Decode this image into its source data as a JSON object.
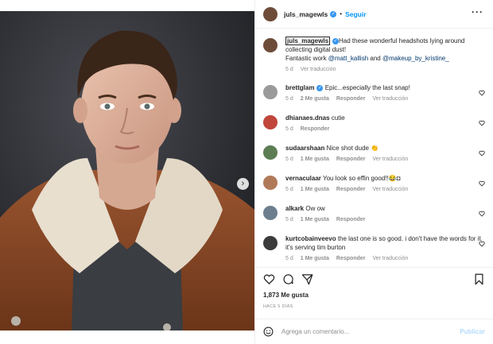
{
  "header": {
    "username": "juls_magewls",
    "separator": "•",
    "follow_label": "Seguir",
    "more_label": "···",
    "verified_mark": "✓"
  },
  "caption": {
    "username": "juls_magewls",
    "text_1": "Had these wonderful headshots lying around collecting digital dust!",
    "text_2": "Fantastic work ",
    "mention_1": "@matt_kallish",
    "and": " and ",
    "mention_2": "@makeup_by_kristine_",
    "time": "5 d",
    "translate": "Ver traducción"
  },
  "comments": [
    {
      "username": "brettglam",
      "text": "Epic...especially the last snap!",
      "time": "5 d",
      "likes": "2 Me gusta",
      "reply": "Responder",
      "translate": "Ver traducción",
      "verified": true,
      "avatar_color": "#9a9a9a"
    },
    {
      "username": "dhianaes.dnas",
      "text": "cutie",
      "time": "5 d",
      "likes": "",
      "reply": "Responder",
      "translate": "",
      "verified": false,
      "avatar_color": "#c0463c"
    },
    {
      "username": "sudaarshaan",
      "text": "Nice shot dude 👏",
      "time": "5 d",
      "likes": "1 Me gusta",
      "reply": "Responder",
      "translate": "Ver traducción",
      "verified": false,
      "avatar_color": "#5d7e54"
    },
    {
      "username": "vernaculaar",
      "text": "You look so effin good!!😂◘",
      "time": "5 d",
      "likes": "1 Me gusta",
      "reply": "Responder",
      "translate": "Ver traducción",
      "verified": false,
      "avatar_color": "#b07a5a"
    },
    {
      "username": "alkark",
      "text": "Ow ow",
      "time": "5 d",
      "likes": "1 Me gusta",
      "reply": "Responder",
      "translate": "",
      "verified": false,
      "avatar_color": "#6d7f8e"
    },
    {
      "username": "kurtcobainveevo",
      "text": "the last one is so good. i don't have the words for it. it's serving tim burton",
      "time": "5 d",
      "likes": "1 Me gusta",
      "reply": "Responder",
      "translate": "Ver traducción",
      "verified": false,
      "avatar_color": "#3b3b3b"
    }
  ],
  "stats": {
    "likes": "1,873 Me gusta",
    "posted": "HACE 5 DÍAS"
  },
  "composer": {
    "placeholder": "Agrega un comentario...",
    "publish_label": "Publicar"
  },
  "carousel": {
    "slides": 5,
    "active": 0,
    "next_label": "›"
  },
  "colors": {
    "accent": "#0095f6",
    "verified": "#3897f0",
    "jacket": "#8a4a26",
    "shearling": "#e6dccb"
  },
  "icons": [
    "heart-icon",
    "comment-icon",
    "share-icon",
    "bookmark-icon",
    "emoji-icon",
    "more-icon",
    "chevron-right-icon"
  ]
}
